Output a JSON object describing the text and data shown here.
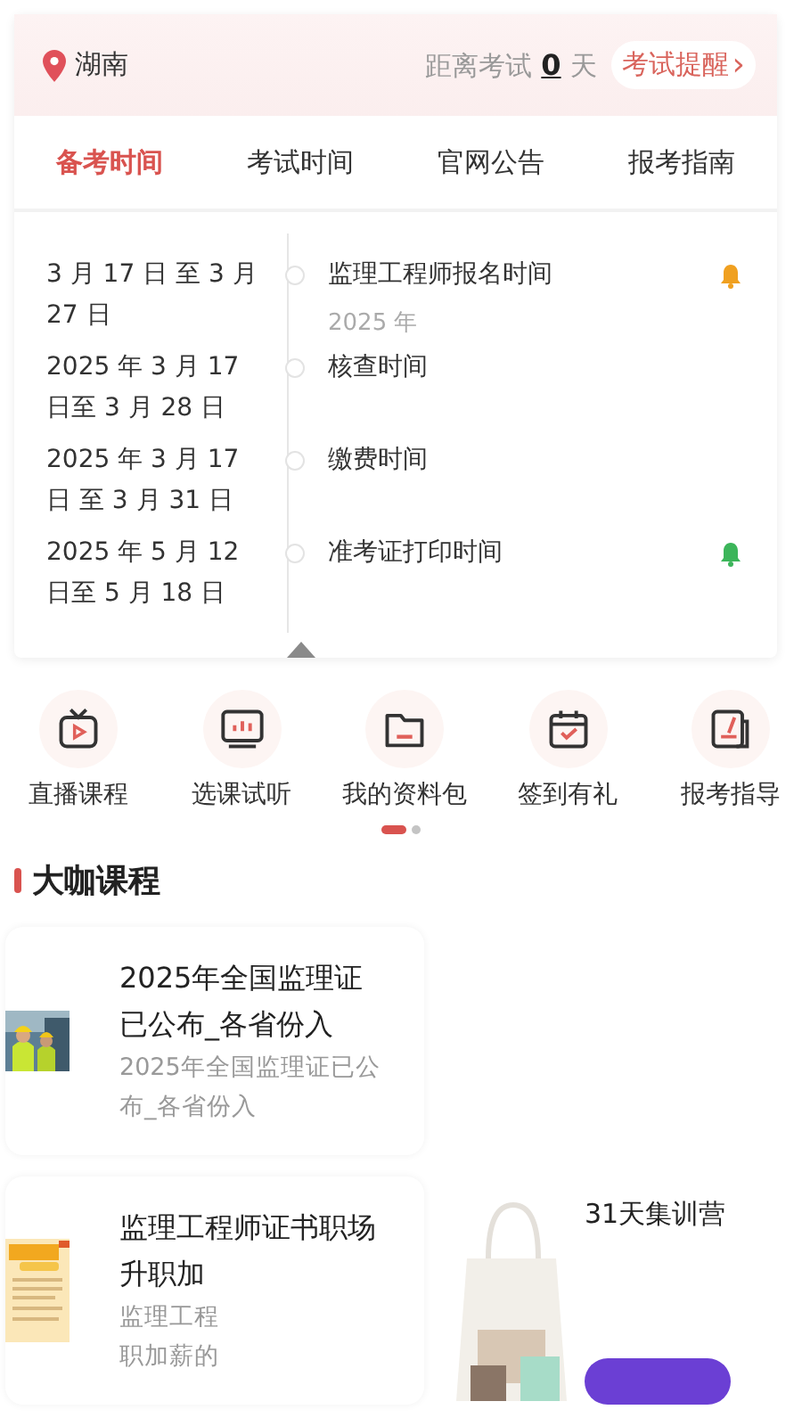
{
  "location": "湖南",
  "countdown": {
    "label": "距离考试",
    "days": "0",
    "unit": "天"
  },
  "reminder_button": {
    "label": "考试提醒",
    "arrow": "›"
  },
  "tabs": [
    {
      "label": "备考时间",
      "selected": true
    },
    {
      "label": "考试时间",
      "selected": false
    },
    {
      "label": "官网公告",
      "selected": false
    },
    {
      "label": "报考指南",
      "selected": false
    }
  ],
  "timeline": [
    {
      "date": "3 月 17 日 至 3 月 27 日",
      "title": "监理工程师报名时间",
      "note": "2025 年",
      "color": "#f0a020"
    },
    {
      "date": "2025 年 3 月 17 日至 3 月 28 日",
      "title": "核查时间"
    },
    {
      "date": "2025 年 3 月 17 日 至 3 月 31 日",
      "title": "缴费时间"
    },
    {
      "date": "2025 年 5 月 12 日至 5 月 18 日",
      "title": "准考证打印时间",
      "color": "#3cb55a"
    }
  ],
  "shortcuts": [
    {
      "label": "直播课程",
      "kind": "tv"
    },
    {
      "label": "选课试听",
      "kind": "monitor"
    },
    {
      "label": "我的资料包",
      "kind": "folder"
    },
    {
      "label": "签到有礼",
      "kind": "calendar"
    },
    {
      "label": "报考指导",
      "kind": "note"
    }
  ],
  "pager": [
    {
      "selected": true
    },
    {
      "selected": false
    }
  ],
  "section_title": "大咖课程",
  "courses": [
    {
      "title": "2025年全国监理证已公布_各省份入",
      "subtitle": [
        "2025年全国监理证已公布_各省份入"
      ]
    },
    {
      "title": "监理工程师证书职场升职加",
      "subtitle": [
        "监理工程",
        "职加薪的"
      ]
    }
  ],
  "promo": {
    "title": "31天集训营"
  }
}
